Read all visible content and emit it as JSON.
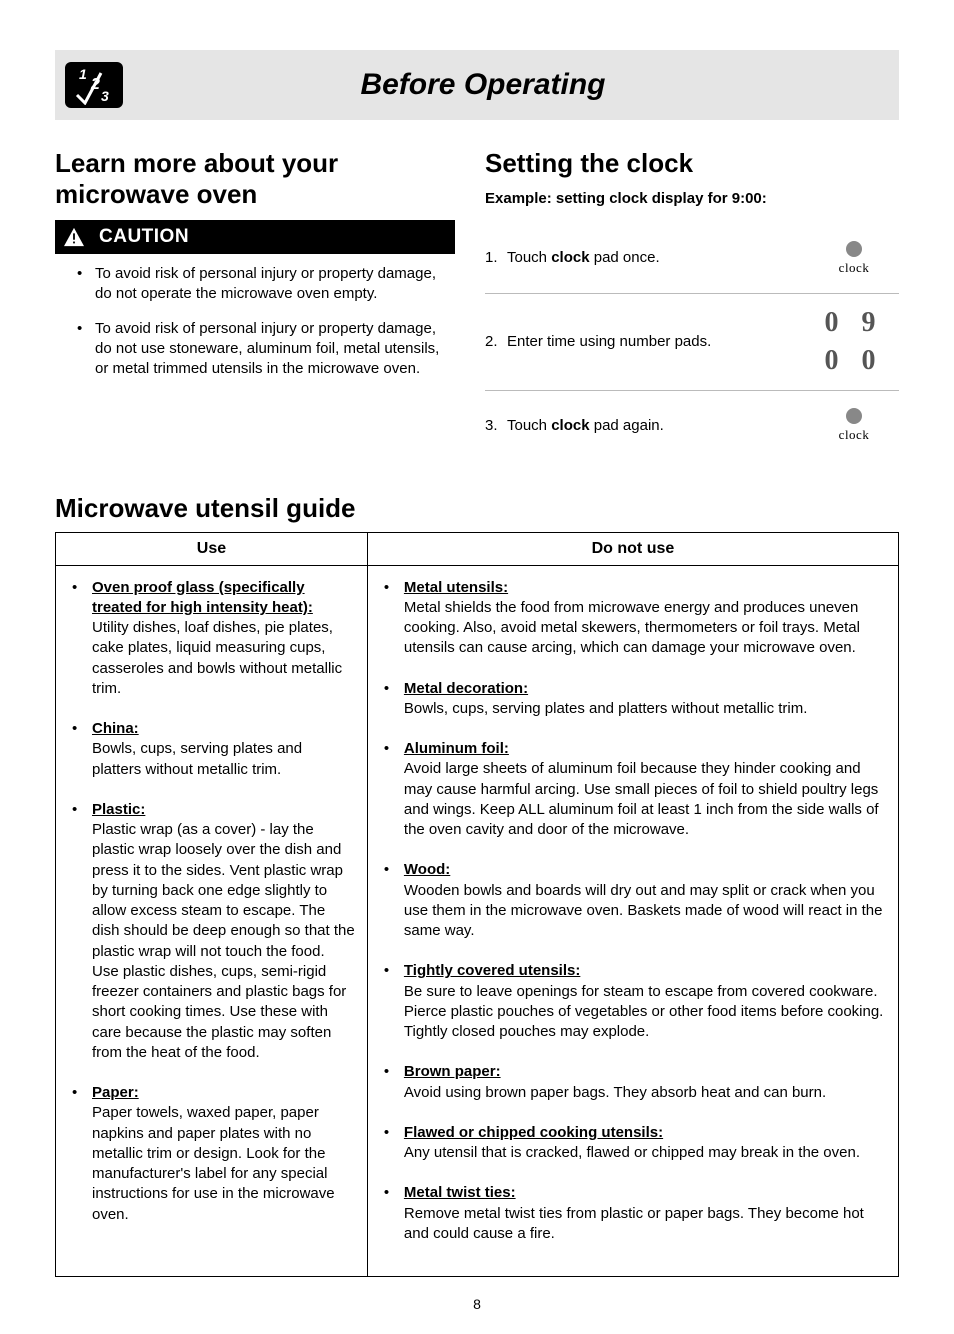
{
  "header": {
    "title": "Before Operating"
  },
  "left": {
    "heading": "Learn more about your microwave oven",
    "caution_label": "CAUTION",
    "cautions": [
      "To avoid risk of personal injury or property damage, do not operate the microwave oven empty.",
      "To avoid risk of personal injury or property damage, do not use stoneware, aluminum foil, metal utensils, or metal trimmed utensils in the microwave oven."
    ]
  },
  "right": {
    "heading": "Setting the clock",
    "example": "Example: setting clock display for 9:00:",
    "steps": {
      "s1_num": "1.",
      "s1_a": "Touch ",
      "s1_b": "clock",
      "s1_c": " pad once.",
      "s2_num": "2.",
      "s2": "Enter time using number pads.",
      "s3_num": "3.",
      "s3_a": "Touch ",
      "s3_b": "clock",
      "s3_c": " pad again."
    },
    "clock_label": "clock",
    "digits": "0 9 0 0"
  },
  "guide": {
    "heading": "Microwave utensil guide",
    "col_use": "Use",
    "col_dont": "Do not use",
    "use": [
      {
        "head": "Oven proof glass (specifically treated for high intensity heat):",
        "body": "Utility dishes, loaf dishes, pie plates, cake plates, liquid measuring cups, casseroles and bowls without metallic trim."
      },
      {
        "head": "China:",
        "body": "Bowls, cups, serving plates and platters without metallic trim."
      },
      {
        "head": "Plastic:",
        "body": "Plastic wrap (as a cover) - lay the plastic wrap loosely over the dish and press it to the sides. Vent plastic wrap by turning back one edge slightly to allow excess steam to escape. The dish should be deep enough so that the plastic wrap will not touch the food. Use plastic dishes, cups, semi-rigid freezer containers and plastic bags for short cooking times. Use these with care because the plastic may soften from the heat of the food."
      },
      {
        "head": "Paper:",
        "body": "Paper towels, waxed paper, paper napkins and paper plates with no metallic trim or design. Look for the manufacturer's label for any special instructions for use in the microwave oven."
      }
    ],
    "dont": [
      {
        "head": "Metal utensils:",
        "body": "Metal shields the food from microwave energy and produces uneven cooking. Also, avoid metal skewers, thermometers or foil trays. Metal utensils can cause arcing, which can damage your microwave oven."
      },
      {
        "head": "Metal decoration:",
        "body": "Bowls, cups, serving plates and platters without metallic trim."
      },
      {
        "head": "Aluminum foil:",
        "body": "Avoid large sheets of aluminum foil because they hinder cooking and may cause harmful arcing. Use small pieces of foil to shield poultry legs and wings. Keep ALL aluminum foil at least 1 inch from the side walls of the oven cavity and door of the microwave."
      },
      {
        "head": "Wood:",
        "body": "Wooden bowls and boards will dry out and may split or crack when you use them in the microwave oven. Baskets made of wood will react in the same way."
      },
      {
        "head": "Tightly covered utensils:",
        "body": "Be sure to leave openings for steam to escape from covered cookware. Pierce plastic pouches of vegetables or other food items before cooking. Tightly closed pouches may explode."
      },
      {
        "head": "Brown paper:",
        "body": "Avoid using brown paper bags. They absorb heat and can burn."
      },
      {
        "head": "Flawed or chipped cooking utensils:",
        "body": "Any utensil that is cracked, flawed or chipped may break in the oven."
      },
      {
        "head": "Metal twist ties:",
        "body": "Remove metal twist ties from plastic or paper bags. They become hot and could cause a fire."
      }
    ]
  },
  "page_number": "8"
}
